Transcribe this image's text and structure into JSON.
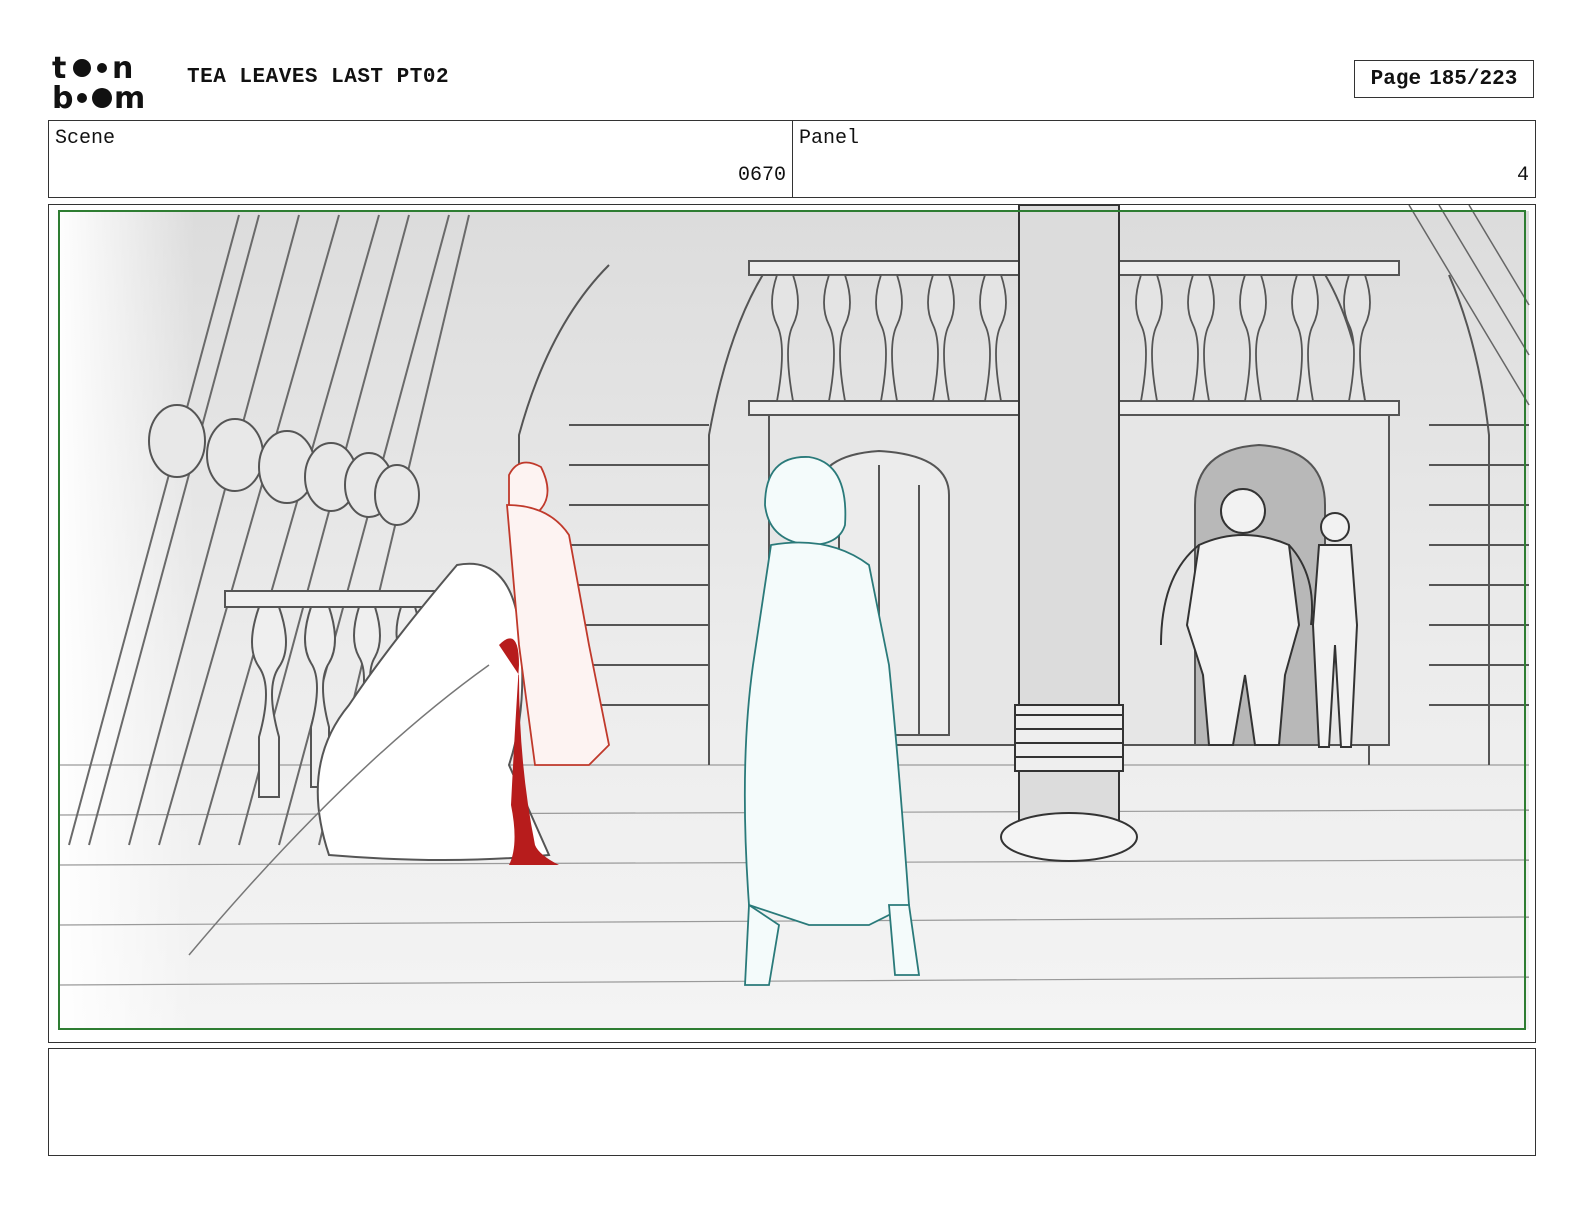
{
  "header": {
    "logo_text": "toon boom",
    "project_title": "TEA LEAVES LAST PT02",
    "page_label": "Page",
    "page_number": "185/223"
  },
  "fields": {
    "scene_label": "Scene",
    "scene_value": "0670",
    "panel_label": "Panel",
    "panel_value": "4"
  },
  "notes": {
    "text": ""
  },
  "colors": {
    "safe_frame": "#2e7d32",
    "blood": "#b71c1c",
    "red_character": "#c0392b",
    "teal_character": "#2a7a7a",
    "line": "#4a4a4a"
  }
}
